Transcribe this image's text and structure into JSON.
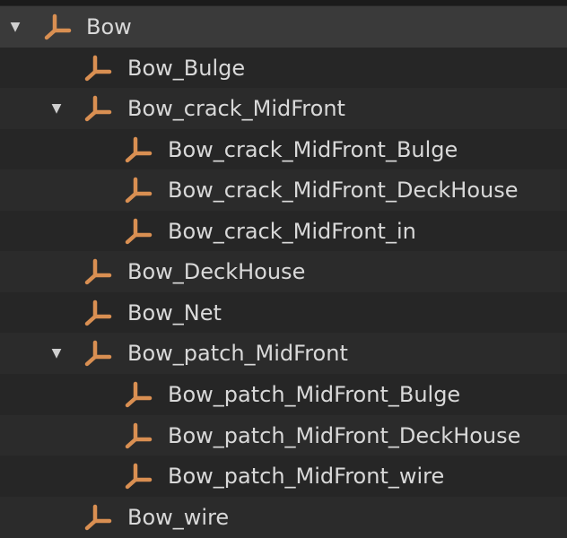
{
  "tree": {
    "root": {
      "label": "Bow",
      "icon": "bone-icon",
      "expanded": true
    },
    "items": [
      {
        "label": "Bow_Bulge",
        "depth": 1,
        "expandable": false
      },
      {
        "label": "Bow_crack_MidFront",
        "depth": 1,
        "expandable": true,
        "expanded": true
      },
      {
        "label": "Bow_crack_MidFront_Bulge",
        "depth": 2,
        "expandable": false
      },
      {
        "label": "Bow_crack_MidFront_DeckHouse",
        "depth": 2,
        "expandable": false
      },
      {
        "label": "Bow_crack_MidFront_in",
        "depth": 2,
        "expandable": false
      },
      {
        "label": "Bow_DeckHouse",
        "depth": 1,
        "expandable": false
      },
      {
        "label": "Bow_Net",
        "depth": 1,
        "expandable": false
      },
      {
        "label": "Bow_patch_MidFront",
        "depth": 1,
        "expandable": true,
        "expanded": true
      },
      {
        "label": "Bow_patch_MidFront_Bulge",
        "depth": 2,
        "expandable": false
      },
      {
        "label": "Bow_patch_MidFront_DeckHouse",
        "depth": 2,
        "expandable": false
      },
      {
        "label": "Bow_patch_MidFront_wire",
        "depth": 2,
        "expandable": false
      },
      {
        "label": "Bow_wire",
        "depth": 1,
        "expandable": false
      }
    ],
    "expanded_glyph": "▼",
    "icon_color": "#d98f52"
  }
}
